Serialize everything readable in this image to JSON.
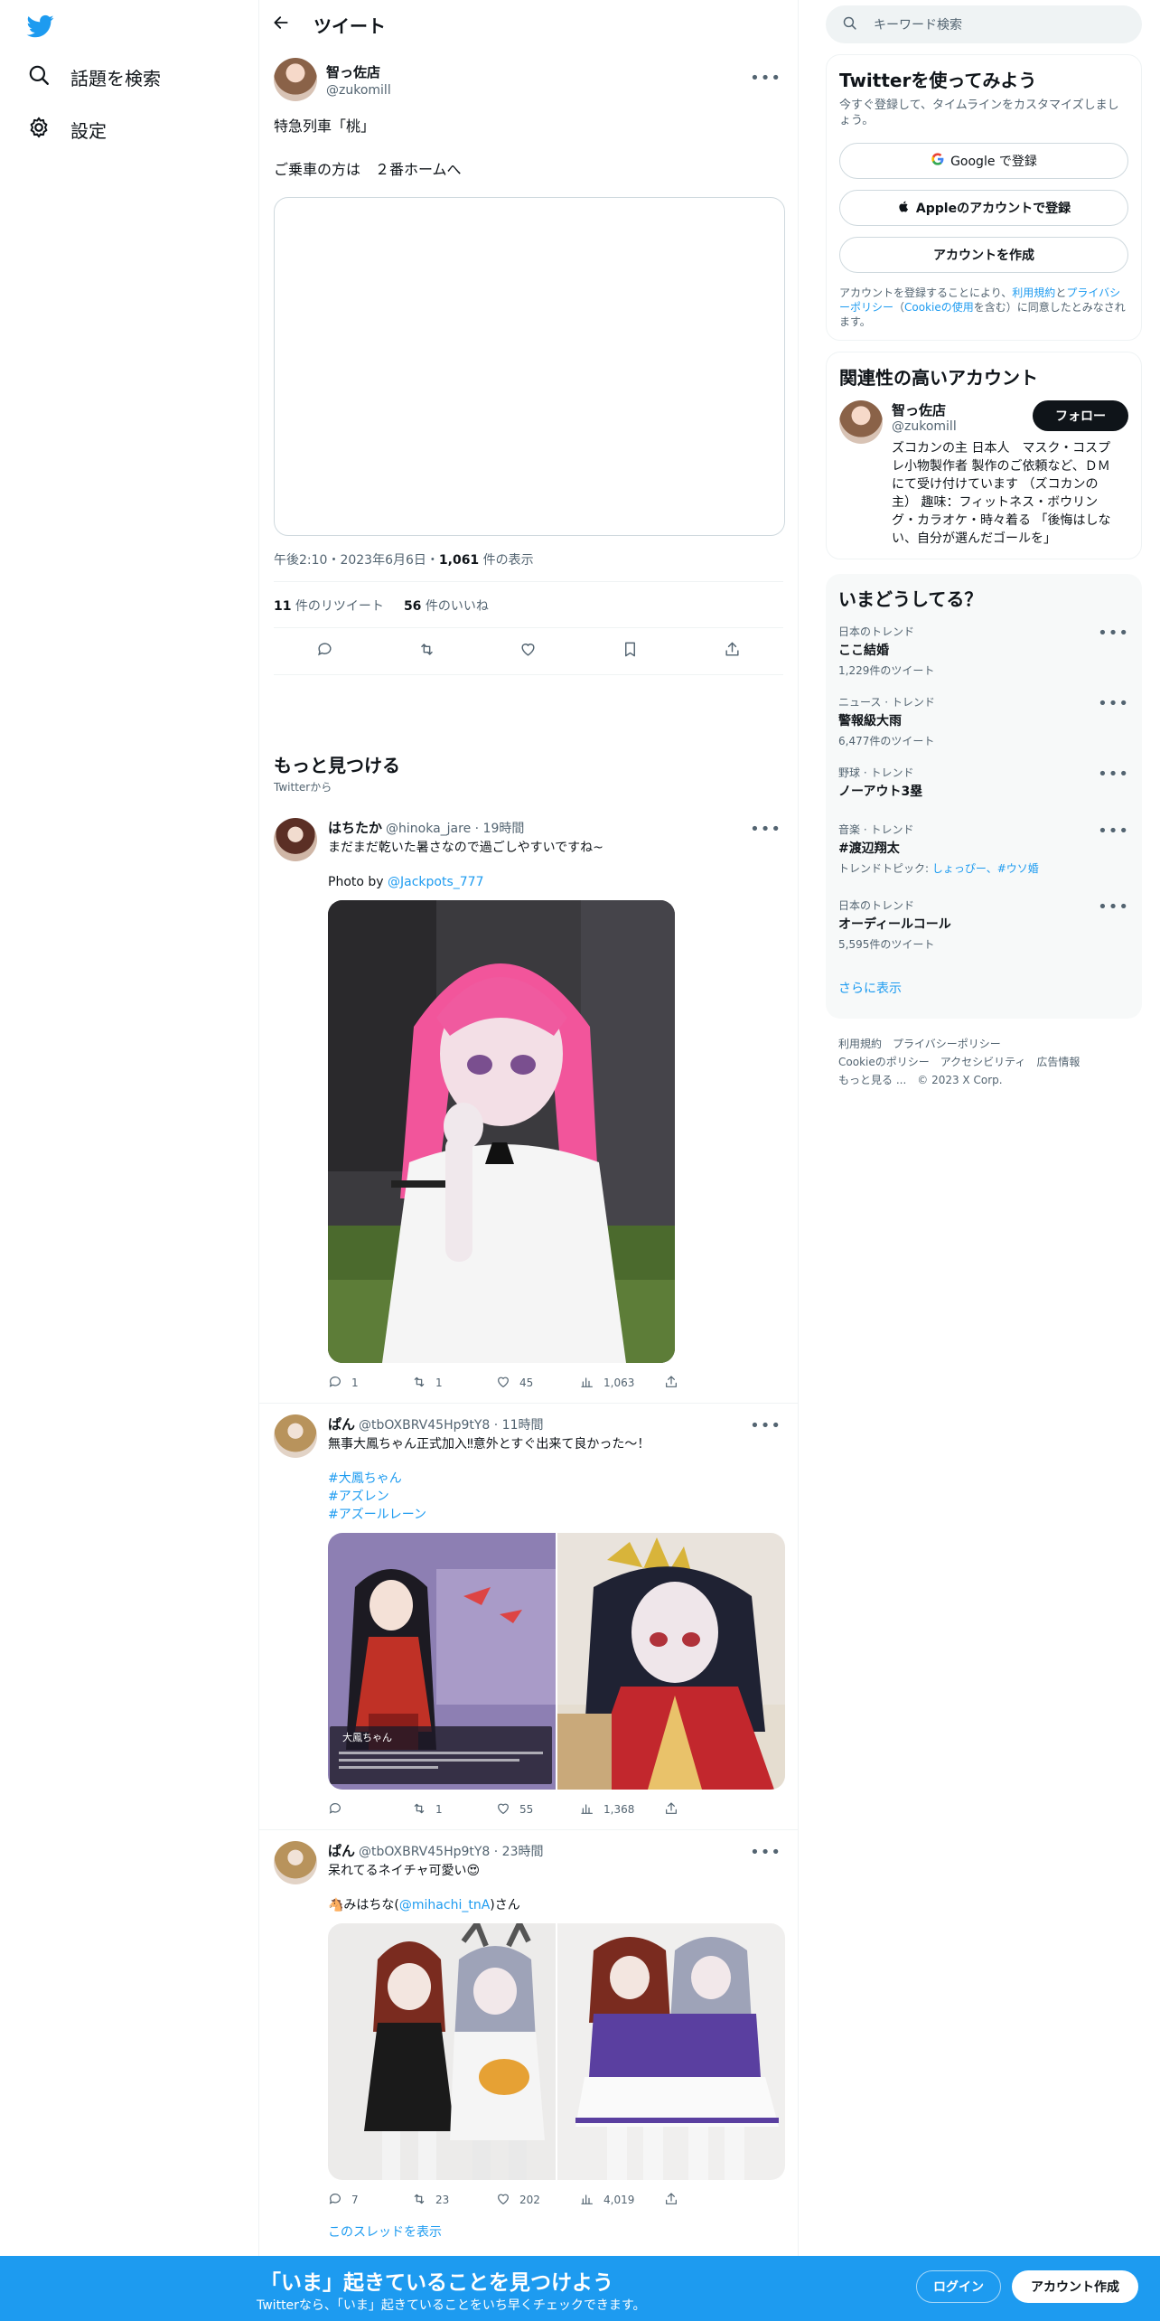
{
  "colors": {
    "accent": "#1d9bf0",
    "text": "#0f1419",
    "muted": "#536471"
  },
  "nav": {
    "logo": "twitter-bird",
    "items": [
      {
        "label": "話題を検索",
        "icon": "search-icon"
      },
      {
        "label": "設定",
        "icon": "gear-icon"
      }
    ]
  },
  "header": {
    "title": "ツイート"
  },
  "main_tweet": {
    "name": "智っ佐店",
    "handle": "@zukomill",
    "lines": [
      "特急列車「桃」",
      "ご乗車の方は　２番ホームへ"
    ],
    "meta_time": "午後2:10・2023年6月6日・",
    "views_num": "1,061",
    "views_label": " 件の表示",
    "retweets_num": "11",
    "retweets_label": " 件のリツイート",
    "likes_num": "56",
    "likes_label": " 件のいいね"
  },
  "more_section": {
    "title": "もっと見つける",
    "subtitle": "Twitterから"
  },
  "tweets": [
    {
      "name": "はちたか",
      "handle_time": "@hinoka_jare · 19時間",
      "text": "まだまだ乾いた暑さなので過ごしやすいですね~",
      "photo_by": "Photo by ",
      "photo_link": "@Jackpots_777",
      "replies": "1",
      "retweets": "1",
      "likes": "45",
      "views": "1,063"
    },
    {
      "name": "ぱん",
      "handle_time": "@tbOXBRV45Hp9tY8 · 11時間",
      "text": "無事大鳳ちゃん正式加入‼意外とすぐ出来て良かった〜！",
      "hashtags": [
        "#大鳳ちゃん",
        "#アズレン",
        "#アズールレーン"
      ],
      "game_label": "大鳳ちゃん",
      "replies": "",
      "retweets": "1",
      "likes": "55",
      "views": "1,368"
    },
    {
      "name": "ぱん",
      "handle_time": "@tbOXBRV45Hp9tY8 · 23時間",
      "text": "呆れてるネイチャ可愛い😍",
      "credit_pre": "🐴みはちな(",
      "credit_link": "@mihachi_tnA",
      "credit_post": ")さん",
      "replies": "7",
      "retweets": "23",
      "likes": "202",
      "views": "4,019",
      "thread_link": "このスレッドを表示"
    }
  ],
  "search": {
    "placeholder": "キーワード検索"
  },
  "signup_card": {
    "title": "Twitterを使ってみよう",
    "subtitle": "今すぐ登録して、タイムラインをカスタマイズしましょう。",
    "google": "Google で登録",
    "apple": "Appleのアカウントで登録",
    "create": "アカウントを作成",
    "legal_pre": "アカウントを登録することにより、",
    "legal_terms": "利用規約",
    "legal_and": "と",
    "legal_privacy": "プライバシーポリシー",
    "legal_paren_open": "（",
    "legal_cookie": "Cookieの使用",
    "legal_post": "を含む）に同意したとみなされます。"
  },
  "relevant": {
    "title": "関連性の高いアカウント",
    "name": "智っ佐店",
    "handle": "@zukomill",
    "follow": "フォロー",
    "bio": "ズコカンの主 日本人　マスク・コスプレ小物製作者 製作のご依頼など、ＤＭにて受け付けています （ズコカンの主） 趣味：フィットネス・ボウリング・カラオケ・時々着る 「後悔はしない、自分が選んだゴールを」"
  },
  "trends": {
    "title": "いまどうしてる？",
    "items": [
      {
        "category": "日本のトレンド",
        "name": "ここ結婚",
        "count": "1,229件のツイート"
      },
      {
        "category": "ニュース · トレンド",
        "name": "警報級大雨",
        "count": "6,477件のツイート"
      },
      {
        "category": "野球 · トレンド",
        "name": "ノーアウト3塁",
        "count": ""
      },
      {
        "category": "音楽 · トレンド",
        "name": "#渡辺翔太",
        "topic_label": "トレンドトピック: ",
        "topic_links": "しょっぴー、#ウソ婚"
      },
      {
        "category": "日本のトレンド",
        "name": "オーディールコール",
        "count": "5,595件のツイート"
      }
    ],
    "show_more": "さらに表示"
  },
  "footer": {
    "links_row1": [
      "利用規約",
      "プライバシーポリシー"
    ],
    "links_row2": [
      "Cookieのポリシー",
      "アクセシビリティ",
      "広告情報"
    ],
    "more": "もっと見る ...",
    "copyright": "© 2023 X Corp."
  },
  "bottom_bar": {
    "headline": "「いま」起きていることを見つけよう",
    "sub": "Twitterなら、「いま」起きていることをいち早くチェックできます。",
    "login": "ログイン",
    "signup": "アカウント作成"
  }
}
